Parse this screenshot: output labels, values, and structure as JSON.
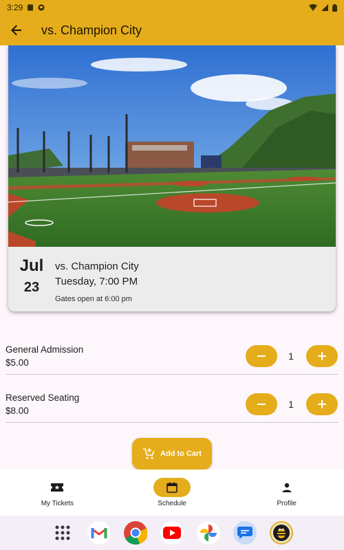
{
  "status_bar": {
    "time": "3:29"
  },
  "app_bar": {
    "title": "vs. Champion City"
  },
  "game": {
    "month": "Jul",
    "day": "23",
    "opponent": "vs. Champion City",
    "datetime": "Tuesday, 7:00 PM",
    "gates": "Gates open at 6:00 pm"
  },
  "tickets": [
    {
      "name": "General Admission",
      "price": "$5.00",
      "quantity": "1"
    },
    {
      "name": "Reserved Seating",
      "price": "$8.00",
      "quantity": "1"
    }
  ],
  "cart": {
    "label": "Add to Cart"
  },
  "nav": {
    "items": [
      {
        "label": "My Tickets",
        "icon": "ticket-icon",
        "active": false
      },
      {
        "label": "Schedule",
        "icon": "calendar-icon",
        "active": true
      },
      {
        "label": "Profile",
        "icon": "person-icon",
        "active": false
      }
    ]
  },
  "dock": {
    "apps": [
      "app-drawer-icon",
      "gmail-icon",
      "chrome-icon",
      "youtube-icon",
      "photos-icon",
      "messages-icon",
      "team-app-icon"
    ]
  },
  "colors": {
    "primary": "#e5ad1b",
    "background": "#fdf6fb",
    "card": "#ececec"
  }
}
